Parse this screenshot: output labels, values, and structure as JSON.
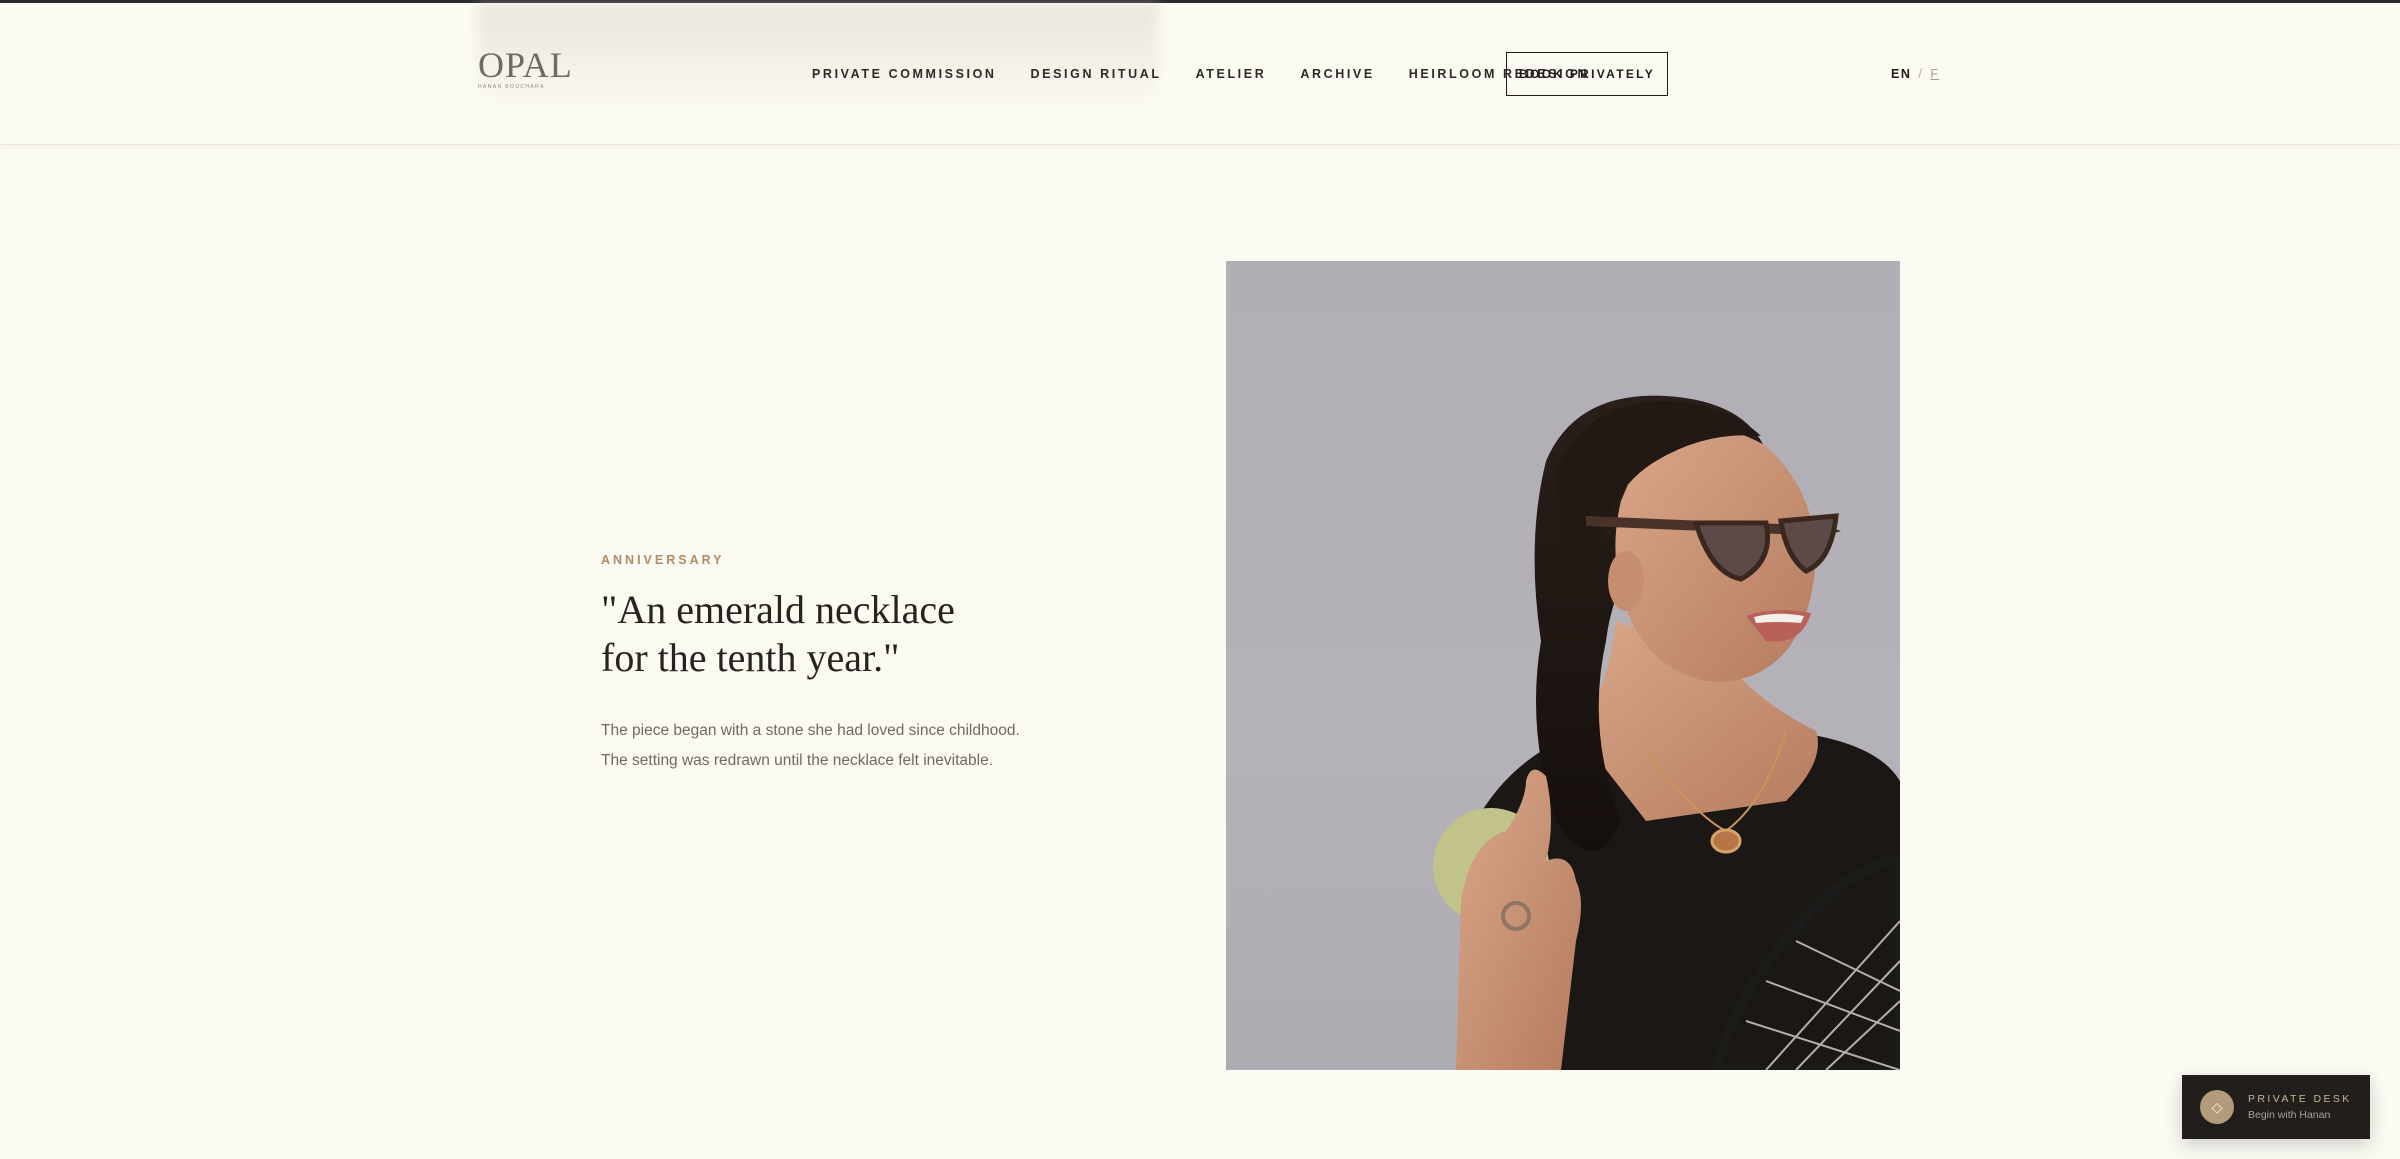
{
  "brand": {
    "logo_word": "OPAL",
    "logo_sub": "HANAN BOUCHARA"
  },
  "nav": {
    "items": [
      "PRIVATE COMMISSION",
      "DESIGN RITUAL",
      "ATELIER",
      "ARCHIVE",
      "HEIRLOOM REDESIGN"
    ],
    "cta_label": "BOOK PRIVATELY"
  },
  "language": {
    "active": "EN",
    "separator": "/",
    "other": "F"
  },
  "hero": {
    "eyebrow": "ANNIVERSARY",
    "quote_line1": "\"An emerald necklace",
    "quote_line2": "for the tenth year.\"",
    "body": "The piece began with a stone she had loved since childhood. The setting was redrawn until the necklace felt inevitable.",
    "image_subject": "woman in cat-eye sunglasses holding a tennis ball and racket, wearing a pendant necklace and ring"
  },
  "private_desk": {
    "title": "PRIVATE DESK",
    "subtitle": "Begin with Hanan",
    "icon": "gem-icon"
  },
  "colors": {
    "page_bg": "#fbfaf3",
    "accent": "#b58a66",
    "dark": "#211e1c",
    "image_bg": "#b1afb5"
  }
}
